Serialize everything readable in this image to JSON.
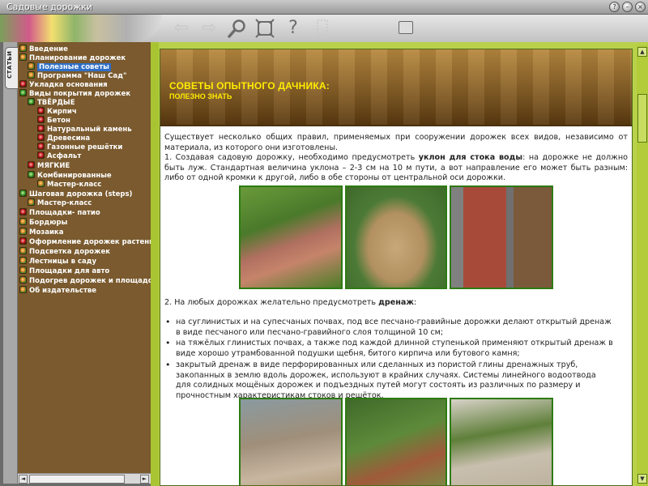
{
  "window": {
    "title": "Садовые дорожки"
  },
  "toolbar": {
    "icons": [
      "back-arrow-icon",
      "forward-arrow-icon",
      "search-magnifier-icon",
      "fullscreen-icon",
      "help-question-icon",
      "bookmark-icon",
      "print-icon"
    ]
  },
  "sidetab": {
    "label": "СТАТЬИ"
  },
  "nav": {
    "items": [
      {
        "label": "Введение"
      },
      {
        "label": "Планирование дорожек"
      },
      {
        "label": "Полезные советы"
      },
      {
        "label": "Программа \"Наш Сад\""
      },
      {
        "label": "Укладка основания"
      },
      {
        "label": "Виды покрытия дорожек"
      },
      {
        "label": "ТВЁРДЫЕ"
      },
      {
        "label": "Кирпич"
      },
      {
        "label": "Бетон"
      },
      {
        "label": "Натуральный камень"
      },
      {
        "label": "Древесина"
      },
      {
        "label": "Газонные решётки"
      },
      {
        "label": "Асфальт"
      },
      {
        "label": "МЯГКИЕ"
      },
      {
        "label": "Комбинированные"
      },
      {
        "label": "Мастер-класс"
      },
      {
        "label": "Шаговая дорожка (steps)"
      },
      {
        "label": "Мастер-класс"
      },
      {
        "label": "Площадки- патио"
      },
      {
        "label": "Бордюры"
      },
      {
        "label": "Мозаика"
      },
      {
        "label": "Оформление дорожек растениями"
      },
      {
        "label": "Подсветка дорожек"
      },
      {
        "label": "Лестницы в саду"
      },
      {
        "label": "Площадки для авто"
      },
      {
        "label": "Подогрев дорожек и площадок"
      },
      {
        "label": "Об издательстве"
      }
    ]
  },
  "article": {
    "title": "СОВЕТЫ ОПЫТНОГО ДАЧНИКА:",
    "subtitle": "ПОЛЕЗНО ЗНАТЬ",
    "intro": "Существует несколько общих правил, применяемых при сооружении дорожек всех видов, независимо от материала, из которого они изготовлены.",
    "p1_pre": "1. Создавая садовую дорожку, необходимо предусмотреть ",
    "p1_bold": "уклон для стока воды",
    "p1_post": ": на дорожке не должно быть луж. Стандартная величина уклона – 2-3 см на 10 м пути, а вот направление его может быть разным: либо от одной кромки к другой, либо в обе стороны от центральной оси дорожки.",
    "p2_pre": "2. На любых дорожках желательно предусмотреть ",
    "p2_bold": "дренаж",
    "p2_post": ":",
    "bullets": [
      "на суглинистых и на супесчаных почвах, под все песчано-гравийные дорожки делают открытый дренаж в виде песчаного или песчано-гравийного слоя толщиной 10 см;",
      "на тяжёлых глинистых почвах, а также под каждой длинной ступенькой применяют открытый дренаж в виде хорошо утрамбованной подушки щебня, битого кирпича или бутового камня;",
      "закрытый дренаж в виде перфорированных или сделанных из пористой глины дренажных труб, закопанных в землю вдоль дорожек, используют в крайних случаях. Системы линейного водоотвода для солидных мощёных дорожек и подъездных путей могут состоять из различных по размеру и прочностным характеристикам стоков и решёток."
    ]
  }
}
